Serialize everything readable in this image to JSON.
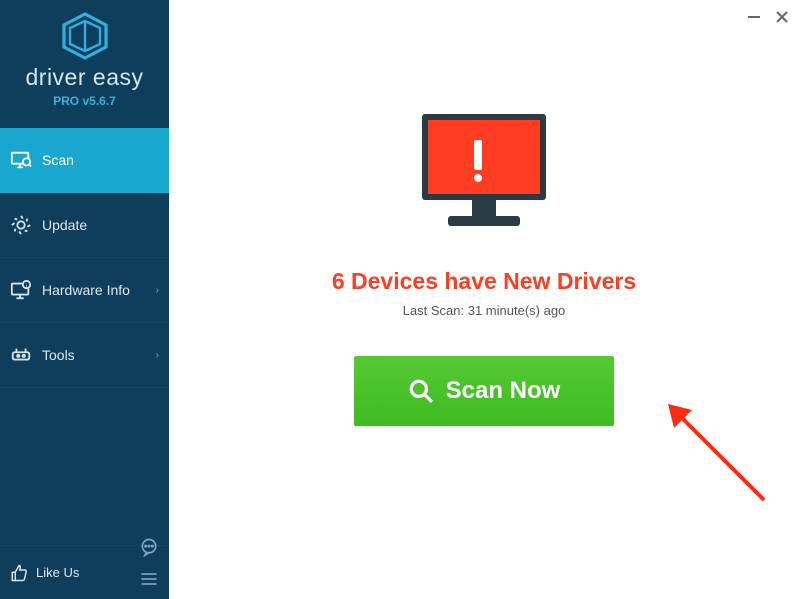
{
  "window": {
    "minimize_label": "–",
    "close_label": "✕"
  },
  "brand": {
    "name": "driver easy",
    "version": "PRO v5.6.7"
  },
  "sidebar": {
    "items": [
      {
        "label": "Scan",
        "icon": "scan-monitor-icon",
        "has_submenu": false,
        "active": true
      },
      {
        "label": "Update",
        "icon": "gear-arrows-icon",
        "has_submenu": false,
        "active": false
      },
      {
        "label": "Hardware Info",
        "icon": "monitor-info-icon",
        "has_submenu": true,
        "active": false
      },
      {
        "label": "Tools",
        "icon": "tools-icon",
        "has_submenu": true,
        "active": false
      }
    ],
    "like_us_label": "Like Us"
  },
  "main": {
    "headline": "6 Devices have New Drivers",
    "last_scan_prefix": "Last Scan: ",
    "last_scan_value": "31 minute(s) ago",
    "scan_button_label": "Scan Now",
    "status_icon": "monitor-alert-icon"
  },
  "colors": {
    "sidebar_bg": "#0f3d5c",
    "sidebar_active": "#19a7cf",
    "alert_red": "#ff3d23",
    "scan_green": "#3fbb22"
  }
}
